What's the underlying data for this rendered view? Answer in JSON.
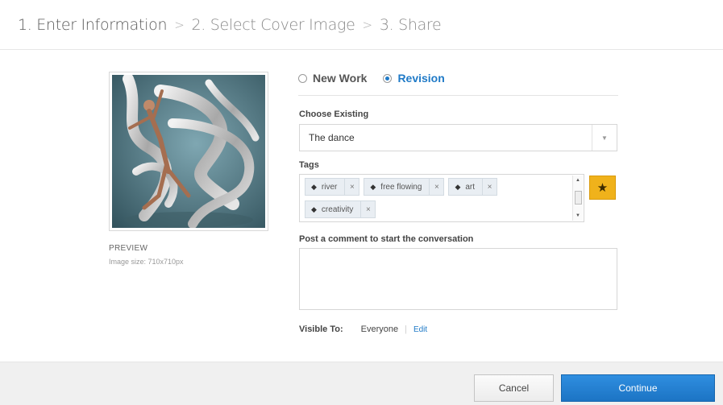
{
  "wizard": {
    "steps": [
      {
        "label": "1. Enter Information",
        "active": true
      },
      {
        "label": "2. Select Cover Image",
        "active": false
      },
      {
        "label": "3. Share",
        "active": false
      }
    ],
    "separator": ">"
  },
  "preview": {
    "label": "PREVIEW",
    "size_text": "Image size: 710x710px"
  },
  "work_type": {
    "options": [
      {
        "label": "New Work",
        "selected": false
      },
      {
        "label": "Revision",
        "selected": true
      }
    ]
  },
  "choose_existing": {
    "label": "Choose Existing",
    "value": "The dance"
  },
  "tags": {
    "label": "Tags",
    "rows": [
      [
        "river",
        "free flowing",
        "art"
      ],
      [
        "creativity"
      ]
    ],
    "star_icon": "star-icon"
  },
  "comment": {
    "label": "Post a comment to start the conversation",
    "value": ""
  },
  "visibility": {
    "label": "Visible To:",
    "value": "Everyone",
    "edit_label": "Edit"
  },
  "footer": {
    "cancel_label": "Cancel",
    "continue_label": "Continue"
  },
  "colors": {
    "accent": "#1f7ac7",
    "star_button": "#f0b21b",
    "continue_button": "#1c74c4"
  }
}
